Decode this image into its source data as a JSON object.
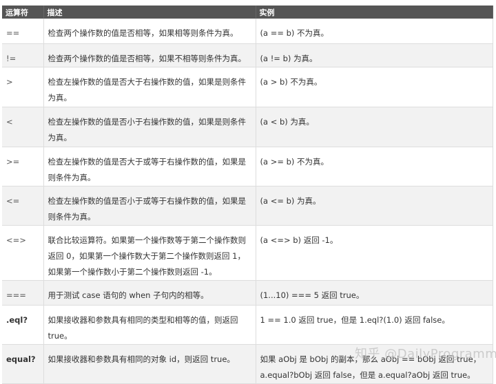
{
  "headers": [
    "运算符",
    "描述",
    "实例"
  ],
  "rows": [
    {
      "op": "==",
      "desc": "检查两个操作数的值是否相等，如果相等则条件为真。",
      "example": "(a == b) 不为真。"
    },
    {
      "op": "!=",
      "desc": "检查两个操作数的值是否相等，如果不相等则条件为真。",
      "example": "(a != b) 为真。"
    },
    {
      "op": ">",
      "desc": "检查左操作数的值是否大于右操作数的值，如果是则条件为真。",
      "example": "(a > b) 不为真。"
    },
    {
      "op": "<",
      "desc": "检查左操作数的值是否小于右操作数的值，如果是则条件为真。",
      "example": "(a < b) 为真。"
    },
    {
      "op": ">=",
      "desc": "检查左操作数的值是否大于或等于右操作数的值，如果是则条件为真。",
      "example": "(a >= b) 不为真。"
    },
    {
      "op": "<=",
      "desc": "检查左操作数的值是否小于或等于右操作数的值，如果是则条件为真。",
      "example": "(a <= b) 为真。"
    },
    {
      "op": "<=>",
      "desc": "联合比较运算符。如果第一个操作数等于第二个操作数则返回 0，如果第一个操作数大于第二个操作数则返回 1，如果第一个操作数小于第二个操作数则返回 -1。",
      "example": "(a <=> b) 返回 -1。"
    },
    {
      "op": "===",
      "desc": "用于测试 case 语句的 when 子句内的相等。",
      "example": "(1...10) === 5 返回 true。"
    },
    {
      "op": ".eql?",
      "desc": "如果接收器和参数具有相同的类型和相等的值，则返回 true。",
      "example": "1 == 1.0 返回 true，但是 1.eql?(1.0) 返回 false。"
    },
    {
      "op": "equal?",
      "desc": "如果接收器和参数具有相同的对象 id，则返回 true。",
      "example": "如果 aObj 是 bObj 的副本，那么 aObj == bObj 返回 true，a.equal?bObj 返回 false，但是 a.equal?aObj 返回 true。"
    }
  ],
  "watermark": "知乎 @DailyProgrammer"
}
